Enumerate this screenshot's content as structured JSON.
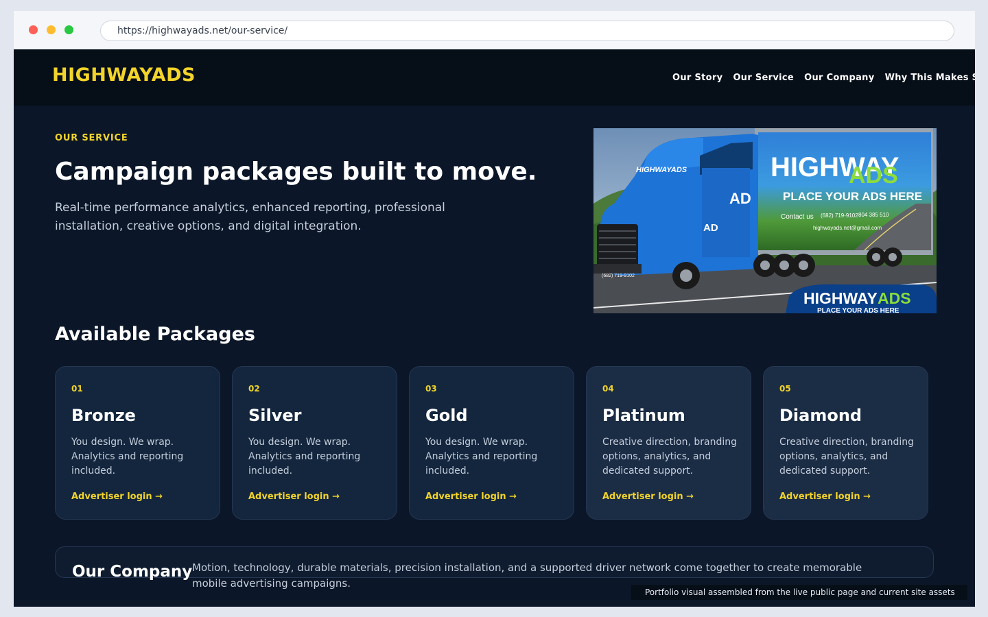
{
  "browser": {
    "url": "https://highwayads.net/our-service/"
  },
  "nav": {
    "logo": "HIGHWAYADS",
    "links": [
      "Our Story",
      "Our Service",
      "Our Company",
      "Why This Makes Sense"
    ]
  },
  "hero": {
    "eyebrow": "OUR SERVICE",
    "title": "Campaign packages built to move.",
    "subtitle": "Real-time performance analytics, enhanced reporting, professional installation, creative options, and digital integration.",
    "image": {
      "cab_text": "HIGHWAYADS",
      "door_text": "AD",
      "trailer_brand_1": "HIGHWAY",
      "trailer_brand_2": "ADS",
      "trailer_slogan": "PLACE YOUR ADS HERE",
      "contact_label": "Contact us",
      "phone_1": "(682) 719-9102",
      "phone_2": "804 385 510",
      "email": "highwayads.net@gmail.com",
      "cab_phone": "(682) 719-9102",
      "badge_brand_1": "HIGHWAY",
      "badge_brand_2": "ADS",
      "badge_slogan": "PLACE YOUR ADS HERE"
    }
  },
  "packages": {
    "title": "Available Packages",
    "items": [
      {
        "num": "01",
        "name": "Bronze",
        "desc": "You design. We wrap. Analytics and reporting included.",
        "link": "Advertiser login →"
      },
      {
        "num": "02",
        "name": "Silver",
        "desc": "You design. We wrap. Analytics and reporting included.",
        "link": "Advertiser login →"
      },
      {
        "num": "03",
        "name": "Gold",
        "desc": "You design. We wrap. Analytics and reporting included.",
        "link": "Advertiser login →"
      },
      {
        "num": "04",
        "name": "Platinum",
        "desc": "Creative direction, branding options, analytics, and dedicated support.",
        "link": "Advertiser login →"
      },
      {
        "num": "05",
        "name": "Diamond",
        "desc": "Creative direction, branding options, analytics, and dedicated support.",
        "link": "Advertiser login →"
      }
    ]
  },
  "company": {
    "title": "Our Company",
    "text": "Motion, technology, durable materials, precision installation, and a supported driver network come together to create memorable mobile advertising campaigns."
  },
  "footnote": "Portfolio visual assembled from the live public page and current site assets",
  "colors": {
    "accent": "#f2d42a",
    "background": "#0b1628",
    "nav_bg": "#060e18",
    "card_bg": "#13263d"
  }
}
